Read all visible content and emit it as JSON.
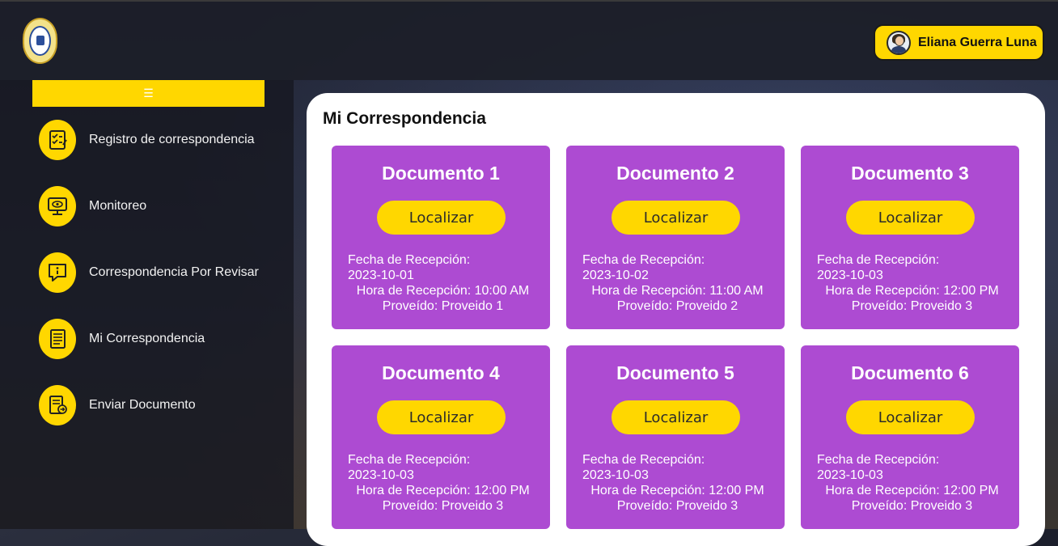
{
  "header": {
    "user_name": "Eliana Guerra Luna"
  },
  "sidebar": {
    "toggle_icon": "☰",
    "items": [
      {
        "label": "Registro de correspondencia",
        "icon": "checklist-icon"
      },
      {
        "label": "Monitoreo",
        "icon": "monitor-eye-icon"
      },
      {
        "label": "Correspondencia Por Revisar",
        "icon": "info-message-icon"
      },
      {
        "label": "Mi Correspondencia",
        "icon": "document-list-icon"
      },
      {
        "label": "Enviar Documento",
        "icon": "send-document-icon"
      }
    ]
  },
  "main": {
    "title": "Mi Correspondencia",
    "cards": [
      {
        "title": "Documento 1",
        "button": "Localizar",
        "fecha_label": "Fecha de Recepción:",
        "fecha": "2023-10-01",
        "hora": "Hora de Recepción: 10:00 AM",
        "proveido": "Proveído: Proveido 1"
      },
      {
        "title": "Documento 2",
        "button": "Localizar",
        "fecha_label": "Fecha de Recepción:",
        "fecha": "2023-10-02",
        "hora": "Hora de Recepción: 11:00 AM",
        "proveido": "Proveído: Proveido 2"
      },
      {
        "title": "Documento 3",
        "button": "Localizar",
        "fecha_label": "Fecha de Recepción:",
        "fecha": "2023-10-03",
        "hora": "Hora de Recepción: 12:00 PM",
        "proveido": "Proveído: Proveido 3"
      },
      {
        "title": "Documento 4",
        "button": "Localizar",
        "fecha_label": "Fecha de Recepción:",
        "fecha": "2023-10-03",
        "hora": "Hora de Recepción: 12:00 PM",
        "proveido": "Proveído: Proveido 3"
      },
      {
        "title": "Documento 5",
        "button": "Localizar",
        "fecha_label": "Fecha de Recepción:",
        "fecha": "2023-10-03",
        "hora": "Hora de Recepción: 12:00 PM",
        "proveido": "Proveído: Proveido 3"
      },
      {
        "title": "Documento 6",
        "button": "Localizar",
        "fecha_label": "Fecha de Recepción:",
        "fecha": "2023-10-03",
        "hora": "Hora de Recepción: 12:00 PM",
        "proveido": "Proveído: Proveido 3"
      }
    ]
  },
  "colors": {
    "accent": "#ffd700",
    "card": "#ad4bd2",
    "sidebar": "#16181f"
  }
}
